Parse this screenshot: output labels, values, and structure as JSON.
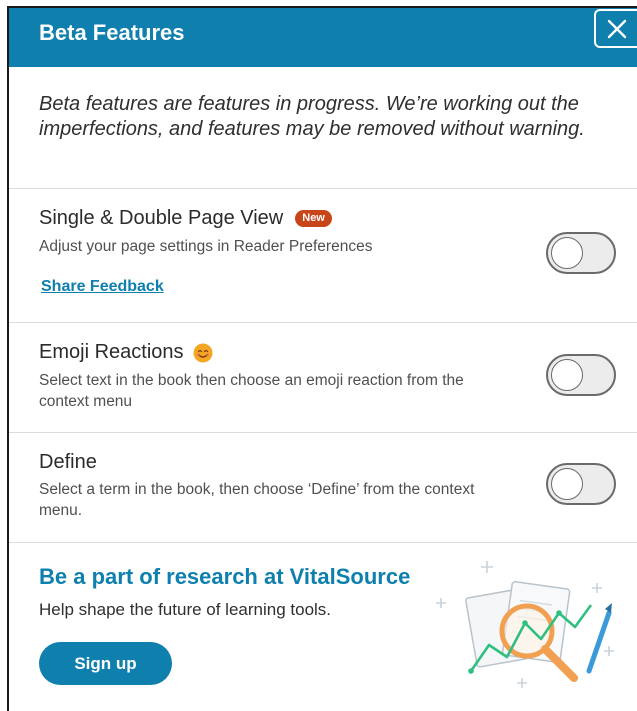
{
  "header": {
    "title": "Beta Features"
  },
  "intro": "Beta features are features in progress. We’re working out the imperfections, and features may be removed without warning.",
  "features": [
    {
      "title": "Single & Double Page View",
      "badge": "New",
      "description": "Adjust your page settings in Reader Preferences",
      "link": "Share Feedback",
      "enabled": false
    },
    {
      "title": "Emoji Reactions",
      "icon": "smiley-emoji-icon",
      "description": "Select text in the book then choose an emoji reaction from the context menu",
      "enabled": false
    },
    {
      "title": "Define",
      "description": "Select a term in the book, then choose ‘Define’ from the context menu.",
      "enabled": false
    }
  ],
  "research": {
    "title": "Be a part of research at VitalSource",
    "description": "Help shape the future of learning tools.",
    "button": "Sign up"
  },
  "colors": {
    "brand": "#0f7fad",
    "badge": "#c8451a",
    "emoji": "#f5a623",
    "chart_line": "#2fbf7f",
    "magnifier": "#f0a050"
  }
}
